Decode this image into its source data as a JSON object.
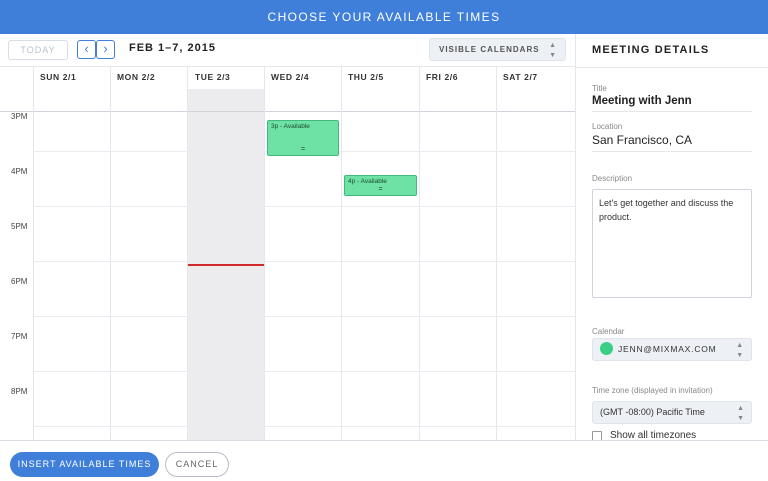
{
  "header": {
    "title": "CHOOSE YOUR AVAILABLE TIMES"
  },
  "toolbar": {
    "today_label": "TODAY",
    "prev_icon": "‹",
    "next_icon": "›",
    "date_range": "FEB 1–7, 2015",
    "visible_calendars_label": "VISIBLE CALENDARS"
  },
  "calendar": {
    "days": [
      "SUN 2/1",
      "MON 2/2",
      "TUE 2/3",
      "WED 2/4",
      "THU 2/5",
      "FRI 2/6",
      "SAT 2/7"
    ],
    "hours": [
      "3PM",
      "4PM",
      "5PM",
      "6PM",
      "7PM",
      "8PM"
    ],
    "today_index": 2,
    "events": [
      {
        "day": "WED 2/4",
        "label": "3p - Available",
        "start": "3:05p",
        "end": "3:45p"
      },
      {
        "day": "THU 2/5",
        "label": "4p - Available",
        "start": "4:05p",
        "end": "4:25p"
      }
    ],
    "current_time": "5:40p"
  },
  "details": {
    "heading": "MEETING DETAILS",
    "title_label": "Title",
    "title_value": "Meeting with Jenn",
    "location_label": "Location",
    "location_value": "San Francisco, CA",
    "description_label": "Description",
    "description_value": "Let's get together and discuss the product.",
    "calendar_label": "Calendar",
    "calendar_value": "JENN@MIXMAX.COM",
    "timezone_label": "Time zone (displayed in invitation)",
    "timezone_value": "(GMT -08:00) Pacific Time",
    "show_all_label": "Show all timezones"
  },
  "footer": {
    "insert_label": "INSERT AVAILABLE TIMES",
    "cancel_label": "CANCEL"
  },
  "colors": {
    "accent": "#3f7fd9",
    "event": "#6ee2a4",
    "now_line": "#d22a2a",
    "calendar_dot": "#3bce86"
  },
  "icons": {
    "select_arrows": "chevron-up-down-icon",
    "prev": "chevron-left-icon",
    "next": "chevron-right-icon"
  }
}
